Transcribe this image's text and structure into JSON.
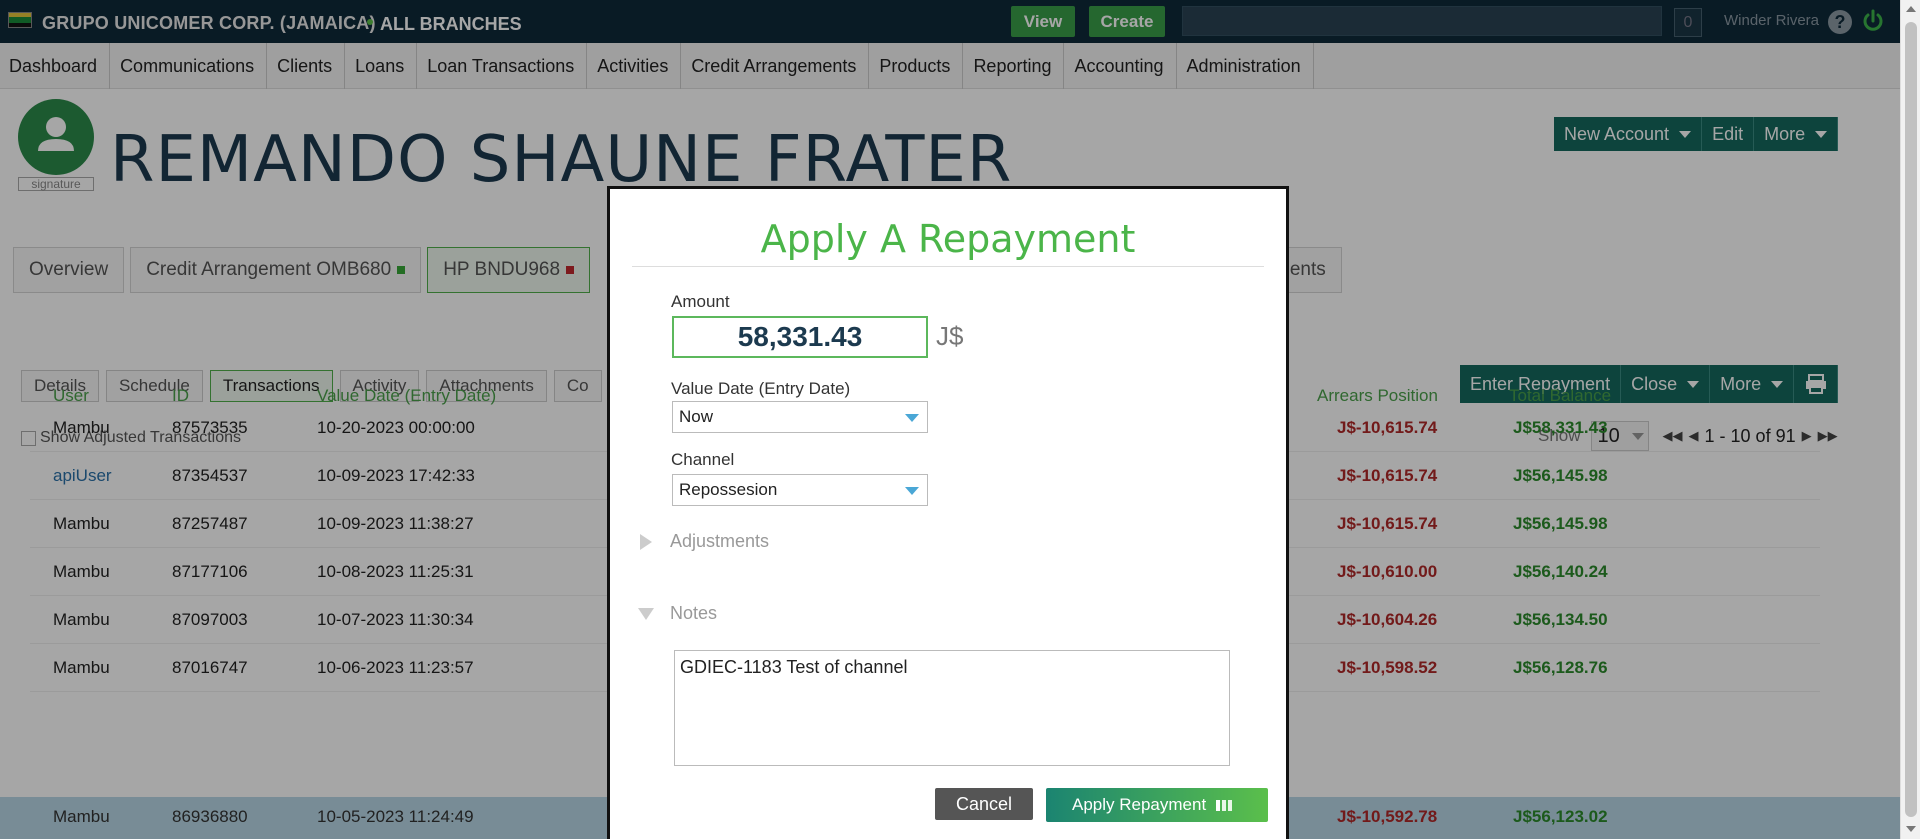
{
  "topbar": {
    "company": "GRUPO UNICOMER CORP. (JAMAICA)",
    "branch": "ALL BRANCHES",
    "view_label": "View",
    "create_label": "Create",
    "notification_count": "0",
    "user": "Winder Rivera",
    "help": "?"
  },
  "nav": [
    "Dashboard",
    "Communications",
    "Clients",
    "Loans",
    "Loan Transactions",
    "Activities",
    "Credit Arrangements",
    "Products",
    "Reporting",
    "Accounting",
    "Administration"
  ],
  "client": {
    "name": "REMANDO SHAUNE FRATER",
    "signature": "signature",
    "buttons": {
      "new_account": "New Account",
      "edit": "Edit",
      "more": "More"
    }
  },
  "account_tabs": {
    "overview": "Overview",
    "credit_arrangement": "Credit Arrangement OMB680",
    "hp": "HP BNDU968",
    "tail": "ments"
  },
  "sub_tabs": [
    "Details",
    "Schedule",
    "Transactions",
    "Activity",
    "Attachments",
    "Co"
  ],
  "tx_buttons": {
    "enter_repayment": "Enter Repayment",
    "close": "Close",
    "more": "More"
  },
  "show_adjusted": "Show Adjusted Transactions",
  "pager": {
    "show_label": "Show",
    "page_size": "10",
    "range": "1 - 10 of 91"
  },
  "table": {
    "headers": {
      "user": "User",
      "id": "ID",
      "value_date": "Value Date (Entry Date)",
      "arrears": "Arrears Position",
      "total": "Total Balance"
    },
    "rows": [
      {
        "user": "Mambu",
        "id": "87573535",
        "date": "10-20-2023 00:00:00",
        "arrears": "J$-10,615.74",
        "total": "J$58,331.43"
      },
      {
        "user": "apiUser",
        "id": "87354537",
        "date": "10-09-2023 17:42:33",
        "arrears": "J$-10,615.74",
        "total": "J$56,145.98"
      },
      {
        "user": "Mambu",
        "id": "87257487",
        "date": "10-09-2023 11:38:27",
        "arrears": "J$-10,615.74",
        "total": "J$56,145.98"
      },
      {
        "user": "Mambu",
        "id": "87177106",
        "date": "10-08-2023 11:25:31",
        "arrears": "J$-10,610.00",
        "total": "J$56,140.24"
      },
      {
        "user": "Mambu",
        "id": "87097003",
        "date": "10-07-2023 11:30:34",
        "arrears": "J$-10,604.26",
        "total": "J$56,134.50"
      },
      {
        "user": "Mambu",
        "id": "87016747",
        "date": "10-06-2023 11:23:57",
        "arrears": "J$-10,598.52",
        "total": "J$56,128.76"
      },
      {
        "user": "Mambu",
        "id": "86936880",
        "date": "10-05-2023 11:24:49",
        "arrears": "J$-10,592.78",
        "total": "J$56,123.02"
      }
    ]
  },
  "modal": {
    "title": "Apply A Repayment",
    "amount_label": "Amount",
    "amount_value": "58,331.43",
    "currency": "J$",
    "value_date_label": "Value Date (Entry Date)",
    "value_date_value": "Now",
    "channel_label": "Channel",
    "channel_value": "Repossesion",
    "adjustments_label": "Adjustments",
    "notes_label": "Notes",
    "notes_value": "GDIEC-1183 Test of channel",
    "cancel_label": "Cancel",
    "apply_label": "Apply Repayment"
  },
  "colors": {
    "brand_green": "#4bb549",
    "teal": "#15695f",
    "topbar": "#0e2a3a",
    "negative": "#b02828",
    "positive": "#2c8a2c"
  }
}
